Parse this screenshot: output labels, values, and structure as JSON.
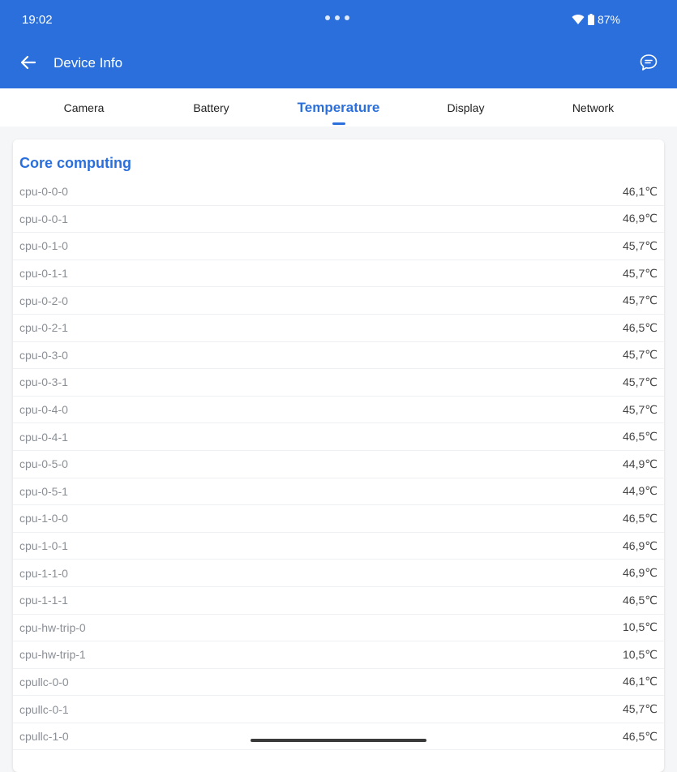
{
  "status_bar": {
    "time": "19:02",
    "battery": "87%"
  },
  "app_bar": {
    "title": "Device Info"
  },
  "tabs": [
    {
      "label": "Camera",
      "active": false
    },
    {
      "label": "Battery",
      "active": false
    },
    {
      "label": "Temperature",
      "active": true
    },
    {
      "label": "Display",
      "active": false
    },
    {
      "label": "Network",
      "active": false
    }
  ],
  "section": {
    "title": "Core computing"
  },
  "rows": [
    {
      "name": "cpu-0-0-0",
      "value": "46,1℃"
    },
    {
      "name": "cpu-0-0-1",
      "value": "46,9℃"
    },
    {
      "name": "cpu-0-1-0",
      "value": "45,7℃"
    },
    {
      "name": "cpu-0-1-1",
      "value": "45,7℃"
    },
    {
      "name": "cpu-0-2-0",
      "value": "45,7℃"
    },
    {
      "name": "cpu-0-2-1",
      "value": "46,5℃"
    },
    {
      "name": "cpu-0-3-0",
      "value": "45,7℃"
    },
    {
      "name": "cpu-0-3-1",
      "value": "45,7℃"
    },
    {
      "name": "cpu-0-4-0",
      "value": "45,7℃"
    },
    {
      "name": "cpu-0-4-1",
      "value": "46,5℃"
    },
    {
      "name": "cpu-0-5-0",
      "value": "44,9℃"
    },
    {
      "name": "cpu-0-5-1",
      "value": "44,9℃"
    },
    {
      "name": "cpu-1-0-0",
      "value": "46,5℃"
    },
    {
      "name": "cpu-1-0-1",
      "value": "46,9℃"
    },
    {
      "name": "cpu-1-1-0",
      "value": "46,9℃"
    },
    {
      "name": "cpu-1-1-1",
      "value": "46,5℃"
    },
    {
      "name": "cpu-hw-trip-0",
      "value": "10,5℃"
    },
    {
      "name": "cpu-hw-trip-1",
      "value": "10,5℃"
    },
    {
      "name": "cpullc-0-0",
      "value": "46,1℃"
    },
    {
      "name": "cpullc-0-1",
      "value": "45,7℃"
    },
    {
      "name": "cpullc-1-0",
      "value": "46,5℃"
    }
  ],
  "colors": {
    "accent": "#2a6fdb",
    "background": "#f5f6f8",
    "card": "#ffffff"
  },
  "icons": [
    "back-arrow-icon",
    "chat-feedback-icon",
    "wifi-icon",
    "battery-icon"
  ]
}
